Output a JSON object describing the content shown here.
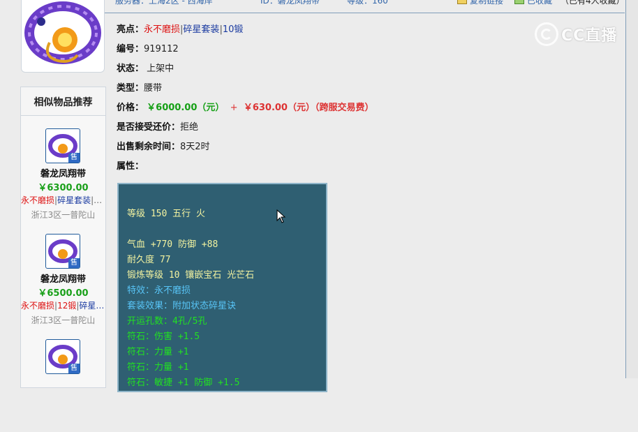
{
  "header": {
    "server_partial": "服务器：上海2区 - 西海岸",
    "id_partial": "ID：磐龙凤翔带",
    "level_partial": "等级：160",
    "copy_link_label": "复制链接",
    "favorited_label": "已收藏",
    "fav_count_partial": "（已有4人收藏）"
  },
  "watermark": {
    "text": "CC直播"
  },
  "left_panel": {
    "title": "相似物品推荐",
    "items": [
      {
        "name": "磐龙凤翔带",
        "price": "￥6300.00",
        "tag1": "永不磨损",
        "tag2": "碎星套装",
        "server": "浙江3区一普陀山",
        "sell_tag": "售"
      },
      {
        "name": "磐龙凤翔带",
        "price": "￥6500.00",
        "tag1": "永不磨损",
        "tag2": "12锻",
        "tag3": "碎星…",
        "server": "浙江3区一普陀山",
        "sell_tag": "售"
      },
      {
        "sell_tag": "售"
      }
    ]
  },
  "details": {
    "highlights_label": "亮点：",
    "highlights": [
      "永不磨损",
      "碎星套装",
      "10锻"
    ],
    "number_label": "编号：",
    "number": "919112",
    "status_label": "状态：",
    "status": "上架中",
    "type_label": "类型：",
    "type": "腰带",
    "price_label": "价格：",
    "price": "￥6000.00（元）",
    "price_plus": "+",
    "fee": "￥630.00（元）（跨服交易费）",
    "counter_label": "是否接受还价：",
    "counter": "拒绝",
    "remaining_label": "出售剩余时间：",
    "remaining": "8天2时",
    "attr_label": "属性："
  },
  "attributes": {
    "lines": [
      {
        "text": "等级 150 五行 火",
        "color": "yellow"
      },
      {
        "text": "气血 +770 防御 +88",
        "color": "yellow"
      },
      {
        "text": "耐久度 77",
        "color": "yellow"
      },
      {
        "text": "锻炼等级 10 镶嵌宝石 光芒石",
        "color": "yellow"
      },
      {
        "text": "特效：永不磨损",
        "color": "cyan"
      },
      {
        "text": "套装效果：附加状态碎星诀",
        "color": "cyan"
      },
      {
        "text": "开运孔数：4孔/5孔",
        "color": "green"
      },
      {
        "text": "符石：伤害 +1.5",
        "color": "green"
      },
      {
        "text": "符石：力量 +1",
        "color": "green"
      },
      {
        "text": "符石：力量 +1",
        "color": "green"
      },
      {
        "text": "符石：敏捷 +1 防御 +1.5",
        "color": "green"
      }
    ]
  }
}
